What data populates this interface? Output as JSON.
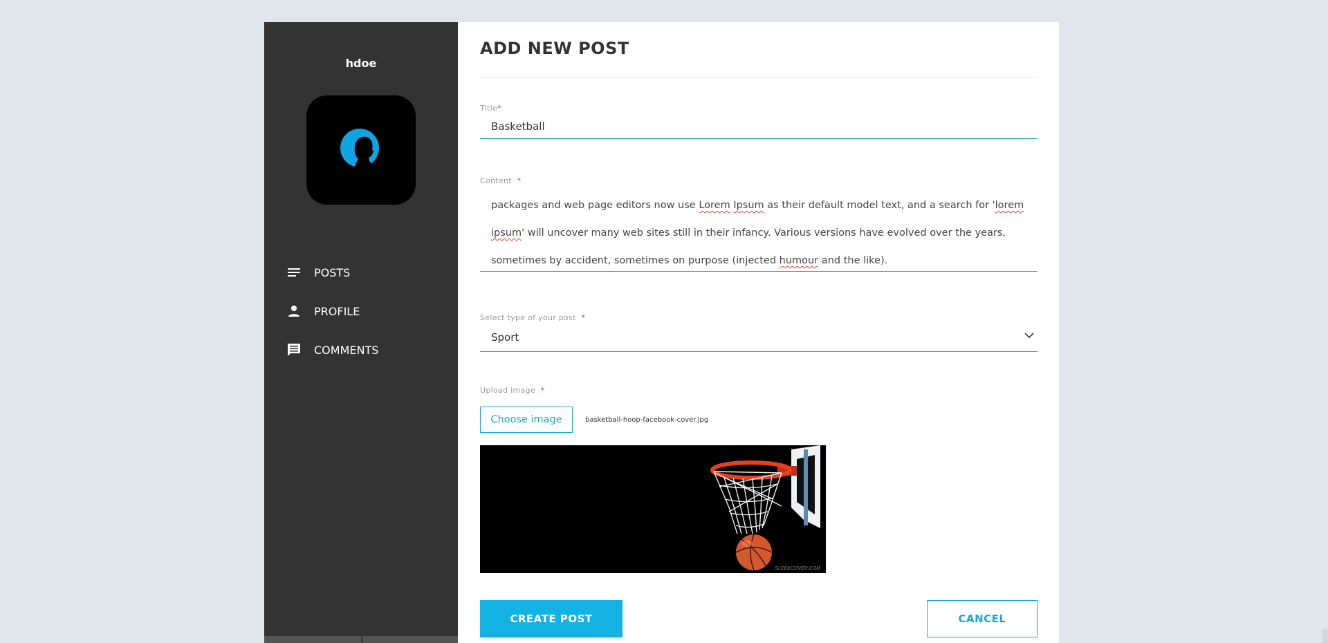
{
  "sidebar": {
    "username": "hdoe",
    "nav": [
      {
        "label": "POSTS",
        "icon": "list-icon"
      },
      {
        "label": "PROFILE",
        "icon": "person-icon"
      },
      {
        "label": "COMMENTS",
        "icon": "comment-icon"
      }
    ]
  },
  "form": {
    "heading": "ADD NEW POST",
    "title_label": "Title",
    "title_value": "Basketball",
    "content_label": "Content",
    "content_parts": {
      "p1": "packages and web page editors now use ",
      "w1": "Lorem",
      "p2": " ",
      "w2": "Ipsum",
      "p3": " as their default model text, and a search for '",
      "w3": "lorem",
      "p4": " ",
      "w4": "ipsum",
      "p5": "' will uncover many web sites still in their infancy. Various versions have evolved over the years, sometimes by accident, sometimes on purpose (injected ",
      "w5": "humour",
      "p6": " and the like)."
    },
    "type_label": "Select type of your post",
    "type_value": "Sport",
    "upload_label": "Upload image",
    "choose_button": "Choose image",
    "file_name": "basketball-hoop-facebook-cover.jpg",
    "image_watermark": "SLEEKCOVER.COM",
    "required_mark": "*",
    "create_button": "CREATE POST",
    "cancel_button": "CANCEL"
  },
  "colors": {
    "accent": "#14b2e3",
    "sidebar_bg": "#333333",
    "required": "#e53935",
    "page_bg": "#e1e6ed"
  }
}
